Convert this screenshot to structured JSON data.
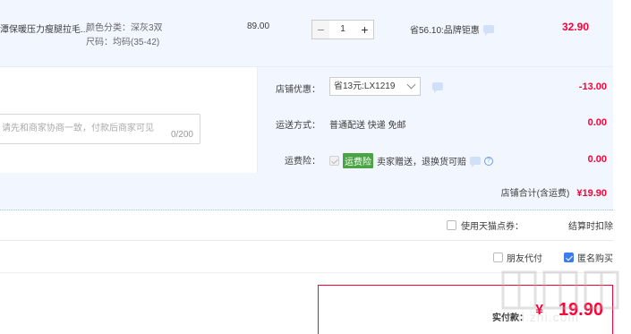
{
  "item": {
    "title": "潭保暖压力瘦腿拉毛...",
    "sku_color": "颜色分类：深灰3双",
    "sku_size": "尺码：均码(35-42)",
    "unit_price": "89.00",
    "quantity": "1",
    "minus": "−",
    "plus": "+",
    "promo": "省56.10:品牌钜惠",
    "subtotal": "32.90"
  },
  "message": {
    "placeholder": "请先和商家协商一致，付款后商家可见",
    "count": "0/200"
  },
  "shop": {
    "discount_label": "店铺优惠：",
    "discount_option": "省13元:LX1219",
    "discount_amount": "-13.00",
    "shipping_label": "运送方式：",
    "shipping_value": "普通配送 快递 免邮",
    "shipping_amount": "0.00",
    "insurance_label": "运费险：",
    "insurance_badge": "运费险",
    "insurance_text": "卖家赠送，退换货可赔",
    "insurance_amount": "0.00",
    "total_label": "店铺合计(含运费)",
    "total_value": "¥19.90"
  },
  "coupon": {
    "label": "使用天猫点券：",
    "note": "结算时扣除"
  },
  "options": {
    "friend_pay": "朋友代付",
    "anonymous": "匿名购买"
  },
  "pay": {
    "label": "实付款：",
    "yen": "¥",
    "amount": "19.90"
  },
  "watermark": "zhi.zhi.com"
}
